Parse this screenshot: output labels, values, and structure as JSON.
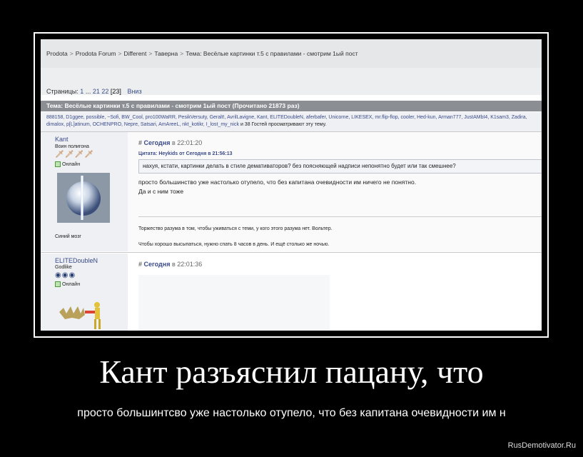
{
  "breadcrumb": [
    "Prodota",
    "Prodota Forum",
    "Different",
    "Таверна",
    "Тема: Весёлые картинки т.5 с правилами - смотрим 1ый пост"
  ],
  "breadcrumb_separator": ">",
  "pagination": {
    "label": "Страницы:",
    "first": "1",
    "ellipsis": "...",
    "pages": [
      "21",
      "22"
    ],
    "current": "[23]",
    "down_link": "Вниз"
  },
  "topic_bar": "Тема: Весёлые картинки т.5 с правилами - смотрим 1ый пост  (Прочитано 21873 раз)",
  "viewers": {
    "names": "888158, D1ggee, possible, ~Sofi, BW_Cool, pro100WaRR, PesikVersuty, Geralt!, AvrilLavigne, Kant, ELITEDoubleN, aferbafer, Unicorne, LIKESEX, mr.flip-flop, cooler, Hed-kun, Arman777, JustAMbI4, K1sam3, Zadira, dimalox, p[L]atinum, OCHENPRO, Nepre, Satsari, AmAreeL, nkt_kotikr, I_lost_my_nick",
    "tail": "и 38 Гостей просматривают эту тему."
  },
  "post1": {
    "user": "Kant",
    "rank": "Воин полигона",
    "stars": "🗡🗡🗡🗡",
    "online": "Онлайн",
    "user_label": "Синий мозг",
    "hash": "#",
    "date_bold": "Сегодня",
    "date_rest": " в 22:01:20",
    "quote_title": "Цитата: Heykids от Сегодня в 21:56:13",
    "quote_text": "нахуя, кстати, картинки делать в стиле демативаторов? без поясняющей надписи непонятно будет или так смешнее?",
    "body_line1": "просто большинство уже настолько отупело, что без капитана очевидности им ничего не понятно.",
    "body_line2": "Да и с ним тоже",
    "sig_line1": "Торжество разума в том, чтобы уживаться с теми, у кого этого разума нет. Вольтер.",
    "sig_line2": "Чтобы хорошо высыпаться, нужно спать 8 часов в день. И ещё столько же ночью."
  },
  "post2": {
    "user": "ELITEDoubleN",
    "rank": "Godlike",
    "stars": "◉◉◉",
    "online": "Онлайн",
    "hash": "#",
    "date_bold": "Сегодня",
    "date_rest": " в 22:01:36"
  },
  "caption": {
    "title": "Кант разъяснил пацану, что",
    "subtitle": "просто большинтсво уже настолько отупело, что без капитана очевидности им н"
  },
  "watermark": "RusDemotivator.Ru",
  "colors": {
    "link_blue": "#3b4b8a",
    "topic_bar_grey": "#8b8e93",
    "background_black": "#000000"
  }
}
